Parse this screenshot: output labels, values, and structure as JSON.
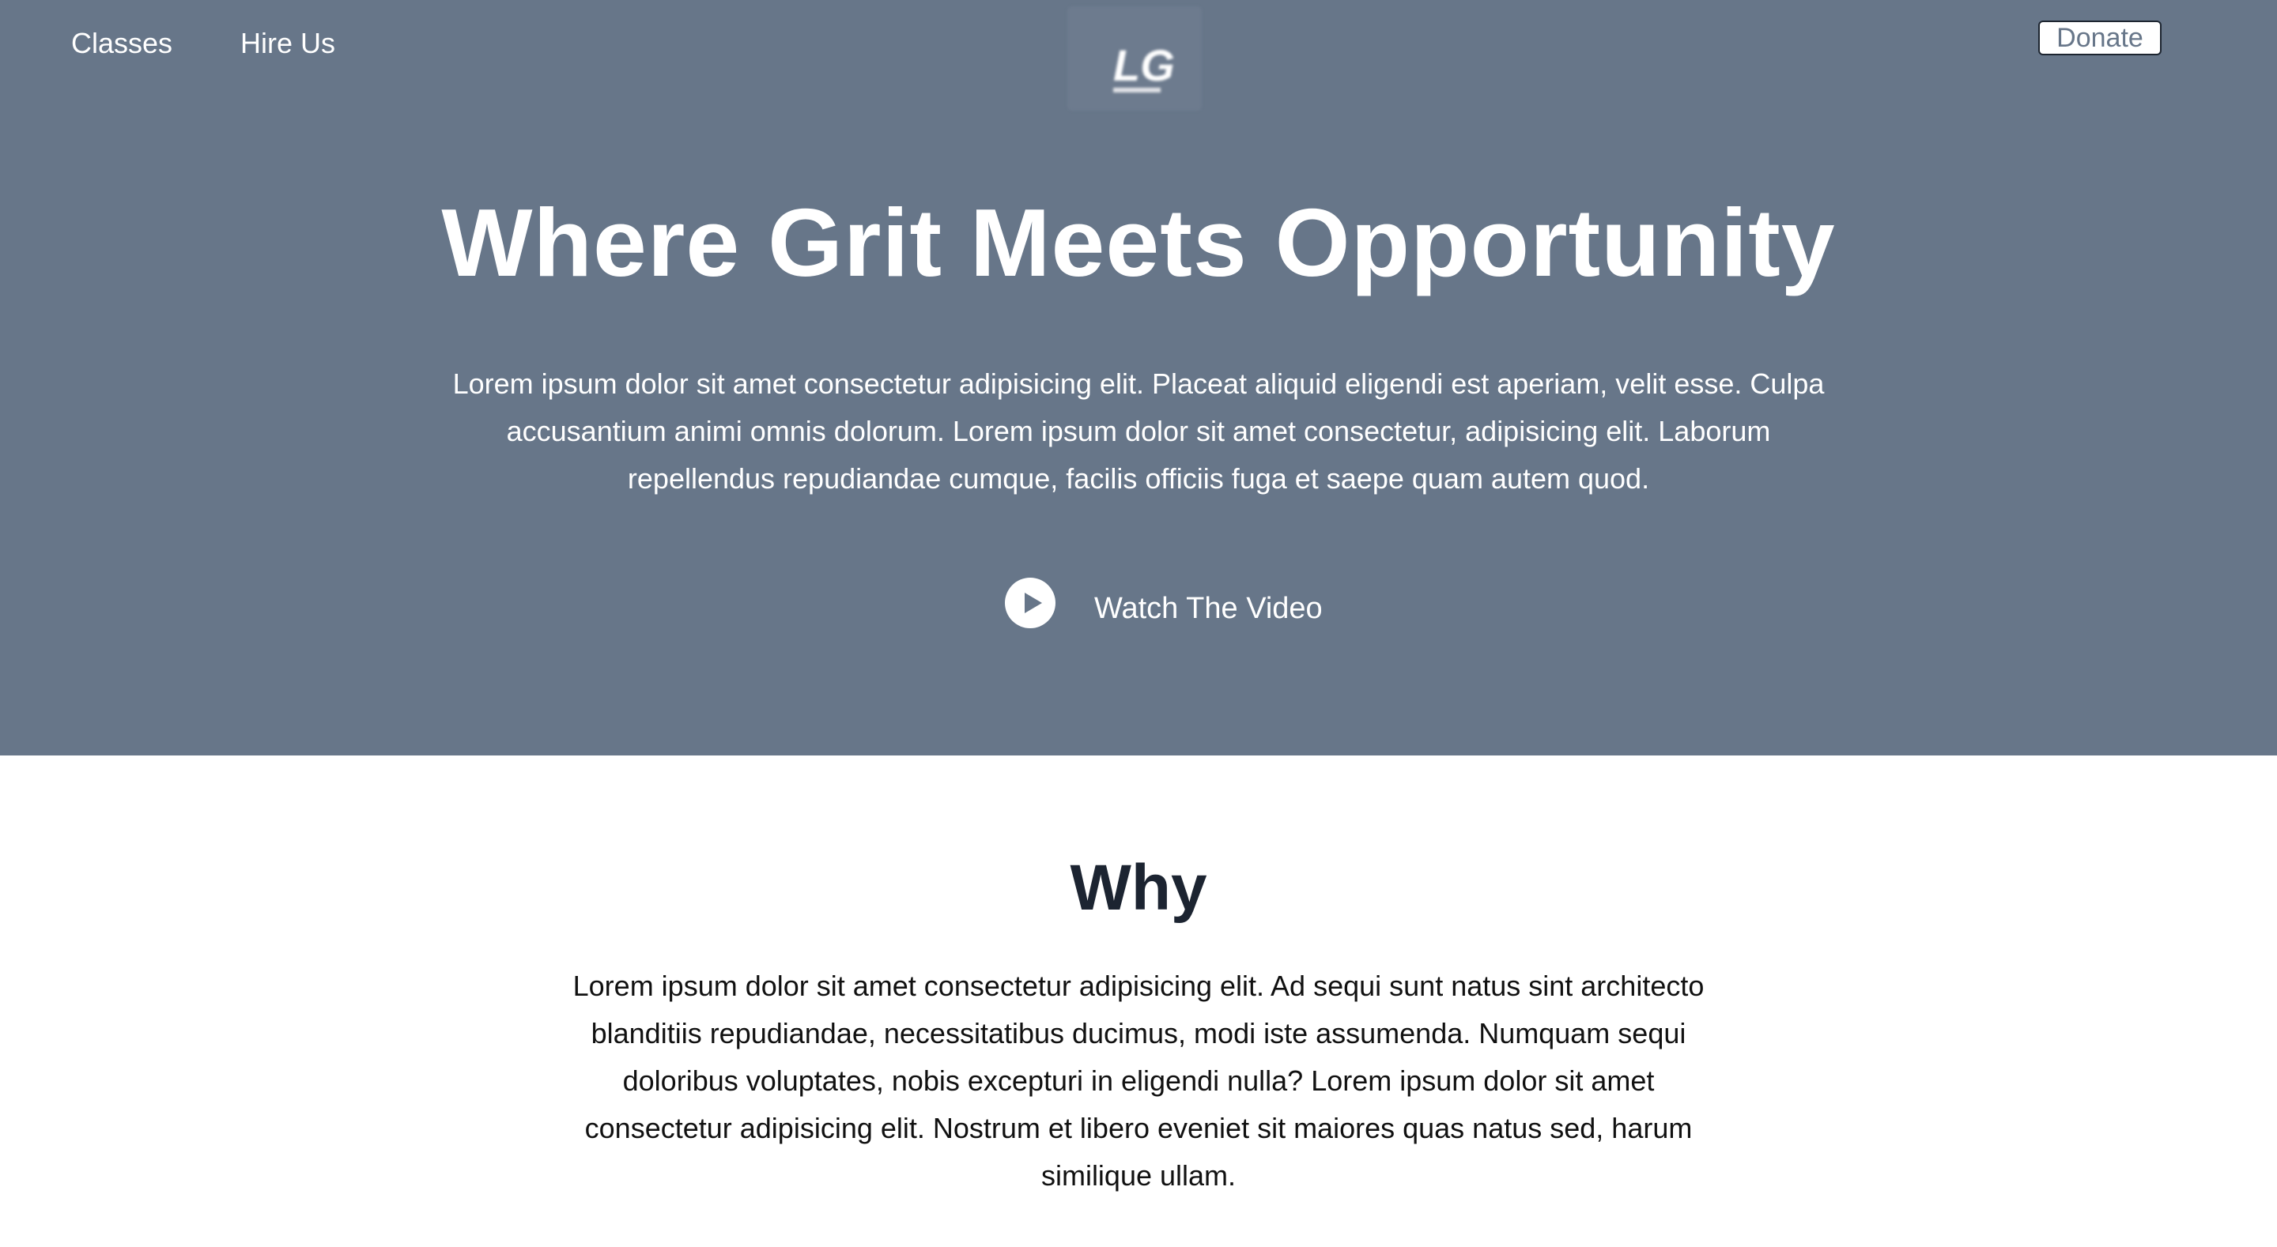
{
  "nav": {
    "classes_label": "Classes",
    "hire_label": "Hire Us",
    "donate_label": "Donate"
  },
  "logo": {
    "text": "LG"
  },
  "hero": {
    "title": "Where Grit Meets Opportunity",
    "text": "Lorem ipsum dolor sit amet consectetur adipisicing elit. Placeat aliquid eligendi est aperiam, velit esse. Culpa accusantium animi omnis dolorum. Lorem ipsum dolor sit amet consectetur, adipisicing elit. Laborum repellendus repudiandae cumque, facilis officiis fuga et saepe quam autem quod.",
    "watch_label": "Watch The Video",
    "watch_icon": "play-icon"
  },
  "why": {
    "title": "Why",
    "text": "Lorem ipsum dolor sit amet consectetur adipisicing elit. Ad sequi sunt natus sint architecto blanditiis repudiandae, necessitatibus ducimus, modi iste assumenda. Numquam sequi doloribus voluptates, nobis excepturi in eligendi nulla? Lorem ipsum dolor sit amet consectetur adipisicing elit. Nostrum et libero eveniet sit maiores quas natus sed, harum similique ullam."
  },
  "colors": {
    "hero_background": "#677689",
    "heading_dark": "#1c2431",
    "donate_text": "#677689"
  }
}
